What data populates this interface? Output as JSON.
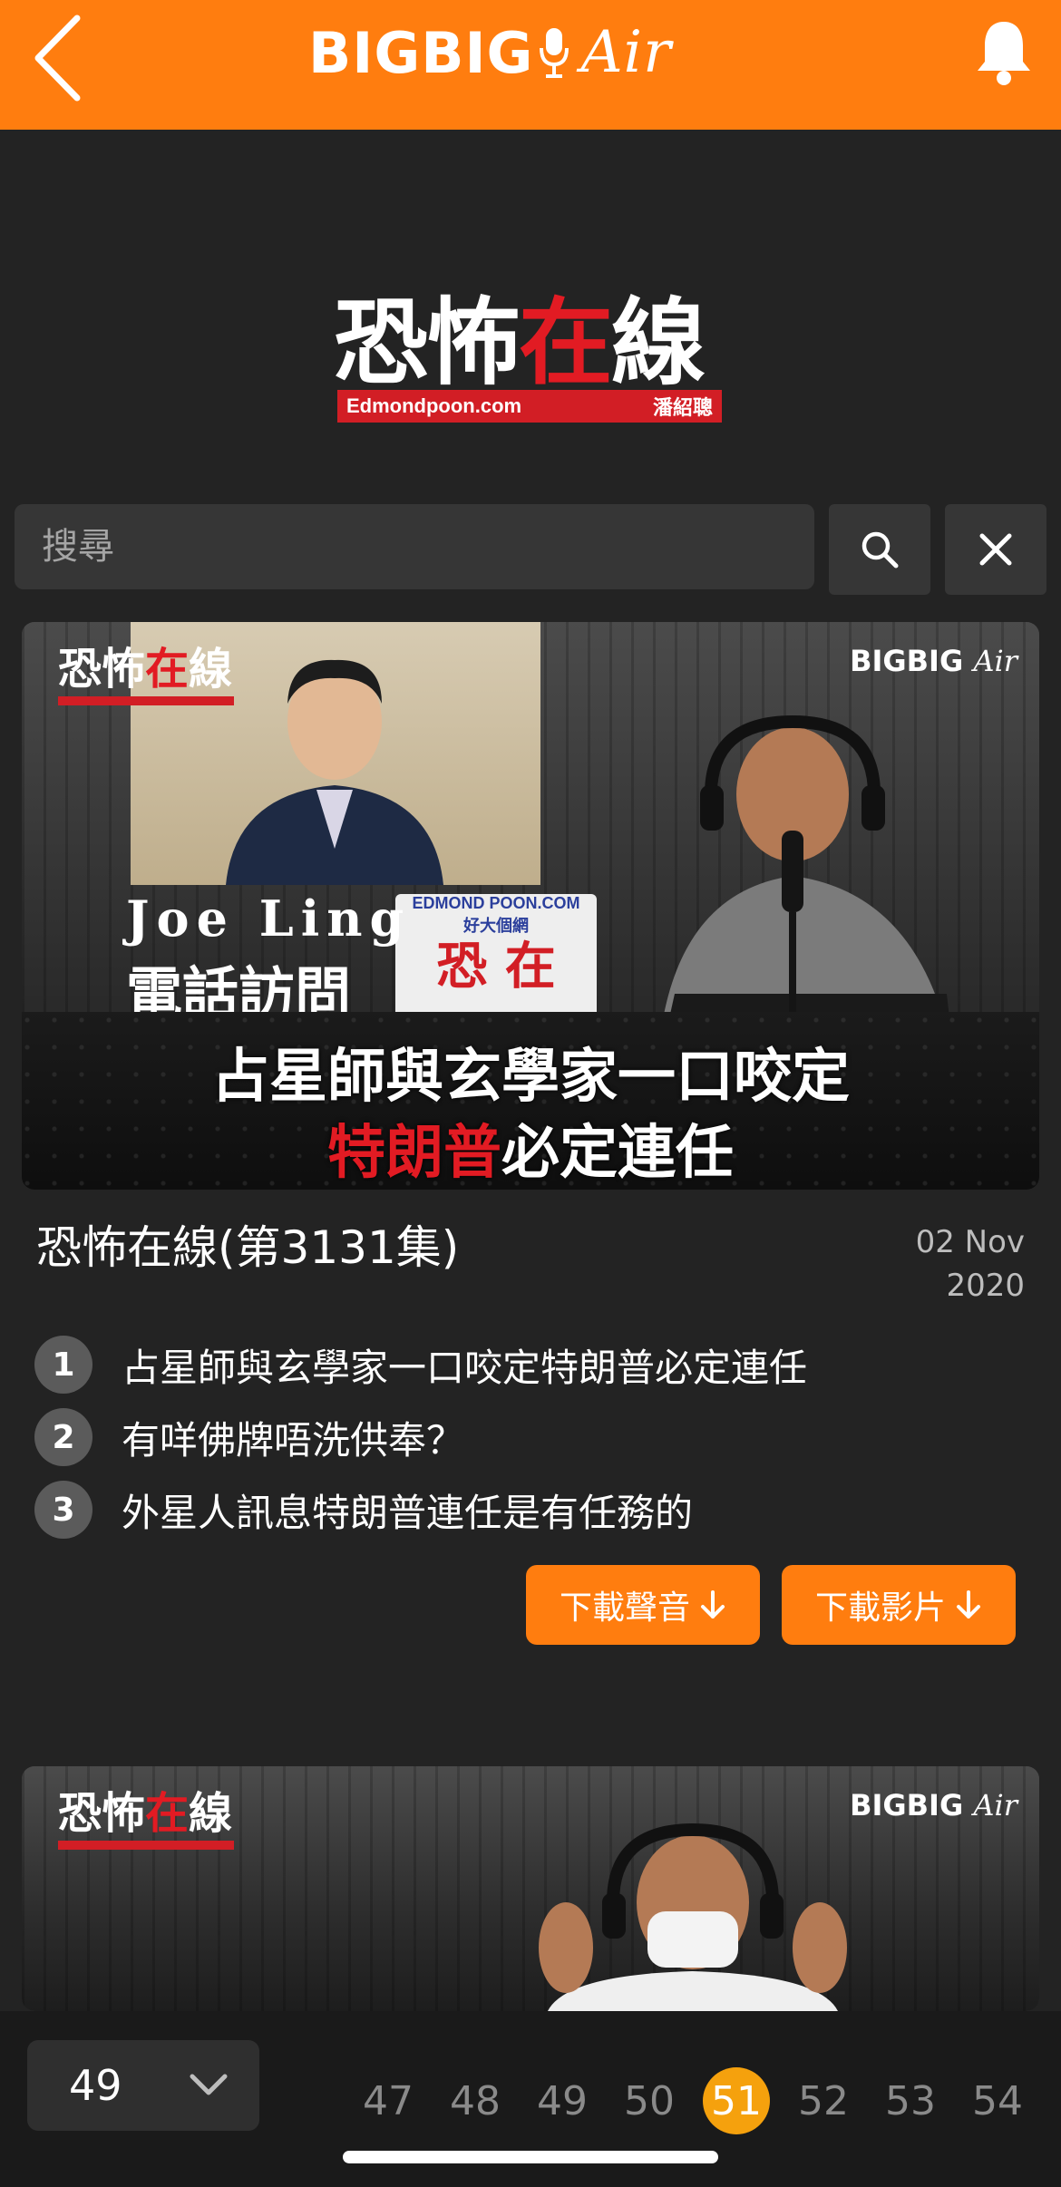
{
  "header": {
    "brand_main": "BIGBIG",
    "brand_script": "Air"
  },
  "show_logo": {
    "title_part1": "恐怖",
    "title_red": "在",
    "title_part2": "線",
    "url": "Edmondpoon.com",
    "host": "潘紹聰"
  },
  "search": {
    "placeholder": "搜尋"
  },
  "episodes": [
    {
      "thumb": {
        "tag_logo_a": "恐怖",
        "tag_logo_b": "在",
        "tag_logo_c": "線",
        "tag_brand": "BIGBIG",
        "tag_brand_script": "Air",
        "guest_name": "Joe Ling",
        "guest_role": "電話訪問",
        "sign_top": "EDMOND POON.COM",
        "sign_sub": "好大個網",
        "sign_big": "恐 在",
        "headline_l1": "占星師與玄學家一口咬定",
        "headline_l2_red": "特朗普",
        "headline_l2_rest": "必定連任"
      },
      "title": "恐怖在線(第3131集)",
      "date_line1": "02 Nov",
      "date_line2": "2020",
      "topics": [
        {
          "num": "1",
          "text": "占星師與玄學家一口咬定特朗普必定連任"
        },
        {
          "num": "2",
          "text": "有咩佛牌唔洗供奉？"
        },
        {
          "num": "3",
          "text": "外星人訊息特朗普連任是有任務的"
        }
      ],
      "download_audio": "下載聲音",
      "download_video": "下載影片"
    },
    {
      "thumb": {
        "tag_logo_a": "恐怖",
        "tag_logo_b": "在",
        "tag_logo_c": "線",
        "tag_brand": "BIGBIG",
        "tag_brand_script": "Air"
      }
    }
  ],
  "pagination": {
    "selected_page": "49",
    "pages": [
      "47",
      "48",
      "49",
      "50",
      "51",
      "52",
      "53",
      "54"
    ],
    "active_page": "51"
  },
  "colors": {
    "accent": "#ff7d0f",
    "active_page": "#f5a10d",
    "background": "#232323",
    "logo_red": "#e21b23"
  }
}
